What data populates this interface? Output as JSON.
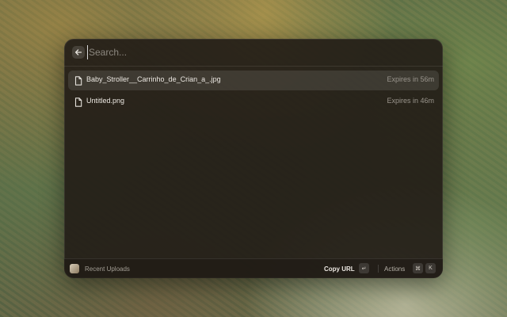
{
  "search": {
    "placeholder": "Search...",
    "value": ""
  },
  "icons": {
    "back": "arrow-left-icon",
    "file": "document-icon",
    "app": "recent-uploads-app-icon",
    "enter": "return-key-icon",
    "command": "command-key-icon"
  },
  "items": [
    {
      "title": "Baby_Stroller__Carrinho_de_Crian_a_.jpg",
      "expires": "Expires in 56m",
      "selected": true
    },
    {
      "title": "Untitled.png",
      "expires": "Expires in 46m",
      "selected": false
    }
  ],
  "footer": {
    "app_name": "Recent Uploads",
    "primary_action": "Copy URL",
    "primary_shortcut": "↵",
    "actions_label": "Actions",
    "actions_shortcut_mod": "⌘",
    "actions_shortcut_key": "K"
  }
}
